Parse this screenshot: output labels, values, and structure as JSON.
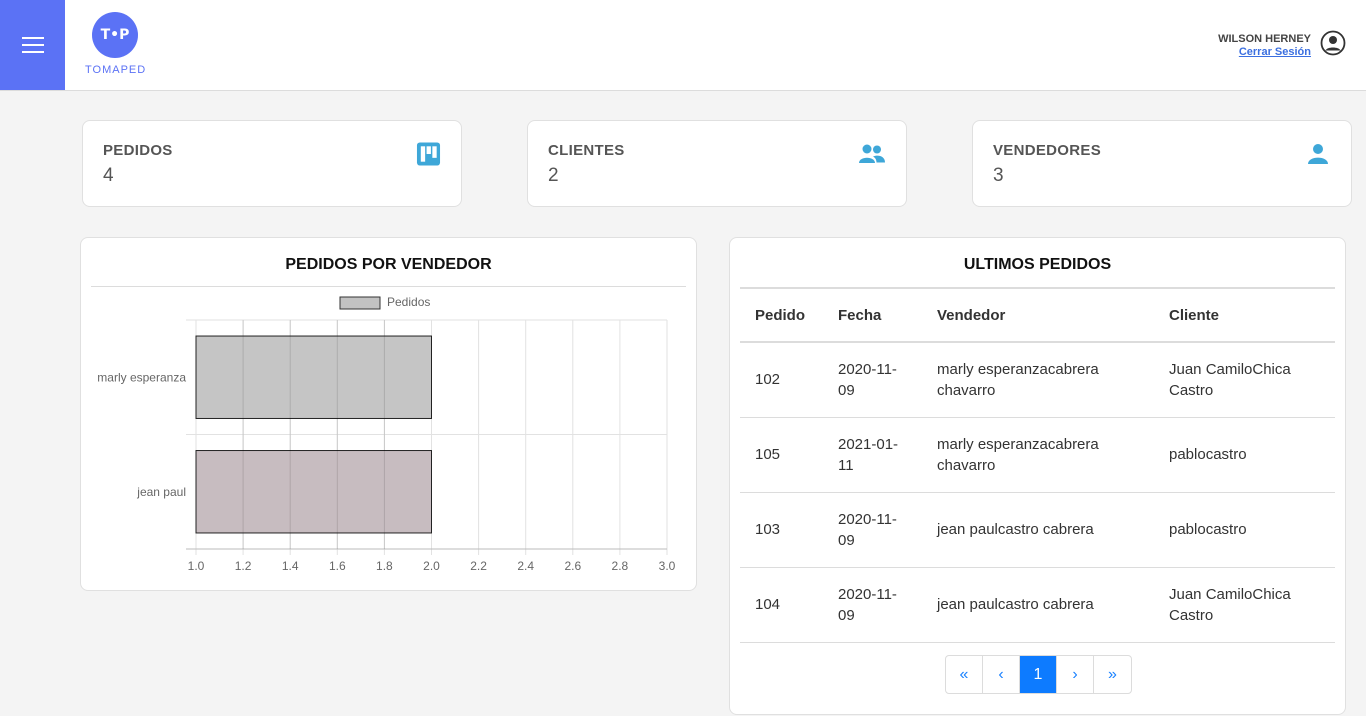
{
  "app": {
    "logo_initials": "T•P",
    "logo_text": "TOMAPED"
  },
  "user": {
    "name": "WILSON HERNEY",
    "logout": "Cerrar Sesión"
  },
  "stats": [
    {
      "title": "PEDIDOS",
      "value": "4",
      "icon": "kanban-icon"
    },
    {
      "title": "CLIENTES",
      "value": "2",
      "icon": "users-icon"
    },
    {
      "title": "VENDEDORES",
      "value": "3",
      "icon": "user-icon"
    }
  ],
  "chart_panel": {
    "title": "PEDIDOS POR VENDEDOR"
  },
  "chart_data": {
    "type": "bar",
    "orientation": "horizontal",
    "categories": [
      "marly esperanza",
      "jean paul"
    ],
    "series": [
      {
        "name": "Pedidos",
        "values": [
          2,
          2
        ]
      }
    ],
    "bar_colors": [
      "#c2c2c2",
      "#c4b8bd"
    ],
    "xlim": [
      1.0,
      3.0
    ],
    "xticks": [
      "1.0",
      "1.2",
      "1.4",
      "1.6",
      "1.8",
      "2.0",
      "2.2",
      "2.4",
      "2.6",
      "2.8",
      "3.0"
    ],
    "legend_position": "top",
    "grid": true
  },
  "orders": {
    "title": "ULTIMOS PEDIDOS",
    "headers": [
      "Pedido",
      "Fecha",
      "Vendedor",
      "Cliente"
    ],
    "rows": [
      [
        "102",
        "2020-11-09",
        "marly esperanzacabrera chavarro",
        "Juan CamiloChica Castro"
      ],
      [
        "105",
        "2021-01-11",
        "marly esperanzacabrera chavarro",
        "pablocastro"
      ],
      [
        "103",
        "2020-11-09",
        "jean paulcastro cabrera",
        "pablocastro"
      ],
      [
        "104",
        "2020-11-09",
        "jean paulcastro cabrera",
        "Juan CamiloChica Castro"
      ]
    ],
    "pagination": {
      "first": "«",
      "prev": "‹",
      "current": "1",
      "next": "›",
      "last": "»"
    }
  },
  "colors": {
    "accent": "#5b72f5",
    "icon": "#3ea7d8",
    "active_page": "#0d7bff"
  }
}
